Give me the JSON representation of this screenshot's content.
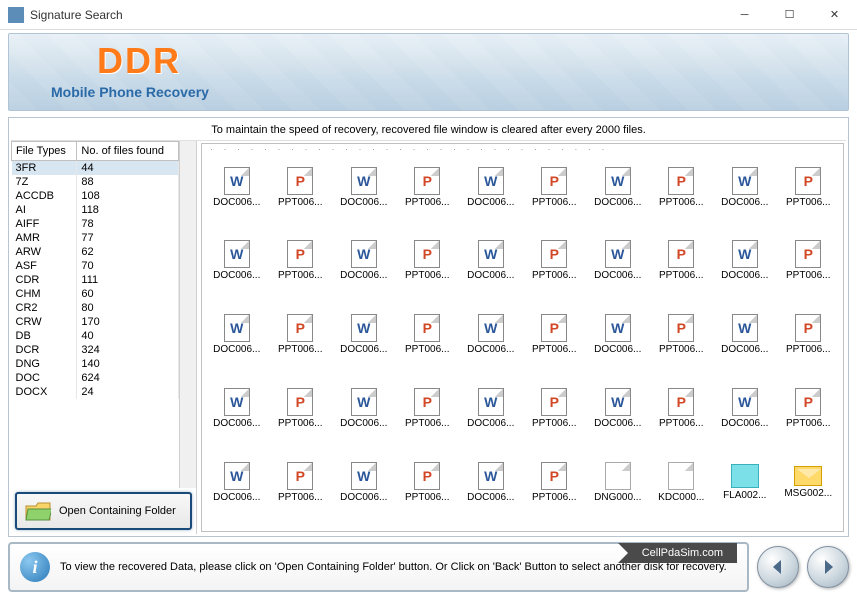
{
  "window": {
    "title": "Signature Search"
  },
  "banner": {
    "brand": "DDR",
    "subtitle": "Mobile Phone Recovery"
  },
  "top_message": "To maintain the speed of recovery, recovered file window is cleared after every 2000 files.",
  "table": {
    "col1": "File Types",
    "col2": "No. of files found",
    "rows": [
      {
        "type": "3FR",
        "count": "44",
        "sel": true
      },
      {
        "type": "7Z",
        "count": "88"
      },
      {
        "type": "ACCDB",
        "count": "108"
      },
      {
        "type": "AI",
        "count": "118"
      },
      {
        "type": "AIFF",
        "count": "78"
      },
      {
        "type": "AMR",
        "count": "77"
      },
      {
        "type": "ARW",
        "count": "62"
      },
      {
        "type": "ASF",
        "count": "70"
      },
      {
        "type": "CDR",
        "count": "111"
      },
      {
        "type": "CHM",
        "count": "60"
      },
      {
        "type": "CR2",
        "count": "80"
      },
      {
        "type": "CRW",
        "count": "170"
      },
      {
        "type": "DB",
        "count": "40"
      },
      {
        "type": "DCR",
        "count": "324"
      },
      {
        "type": "DNG",
        "count": "140"
      },
      {
        "type": "DOC",
        "count": "624"
      },
      {
        "type": "DOCX",
        "count": "24"
      }
    ]
  },
  "open_button": "Open Containing Folder",
  "files": {
    "row_pattern": [
      {
        "name": "DOC006...",
        "kind": "doc"
      },
      {
        "name": "PPT006...",
        "kind": "ppt"
      },
      {
        "name": "DOC006...",
        "kind": "doc"
      },
      {
        "name": "PPT006...",
        "kind": "ppt"
      },
      {
        "name": "DOC006...",
        "kind": "doc"
      },
      {
        "name": "PPT006...",
        "kind": "ppt"
      },
      {
        "name": "DOC006...",
        "kind": "doc"
      },
      {
        "name": "PPT006...",
        "kind": "ppt"
      },
      {
        "name": "DOC006...",
        "kind": "doc"
      },
      {
        "name": "PPT006...",
        "kind": "ppt"
      }
    ],
    "last_row": [
      {
        "name": "DOC006...",
        "kind": "doc"
      },
      {
        "name": "PPT006...",
        "kind": "ppt"
      },
      {
        "name": "DOC006...",
        "kind": "doc"
      },
      {
        "name": "PPT006...",
        "kind": "ppt"
      },
      {
        "name": "DOC006...",
        "kind": "doc"
      },
      {
        "name": "PPT006...",
        "kind": "ppt"
      },
      {
        "name": "DNG000...",
        "kind": "blank"
      },
      {
        "name": "KDC000...",
        "kind": "blank"
      },
      {
        "name": "FLA002...",
        "kind": "fla"
      },
      {
        "name": "MSG002...",
        "kind": "msg"
      }
    ]
  },
  "info_text": "To view the recovered Data, please click on 'Open Containing Folder' button. Or Click on 'Back' Button to select another disk for recovery.",
  "ribbon": "CellPdaSim.com"
}
